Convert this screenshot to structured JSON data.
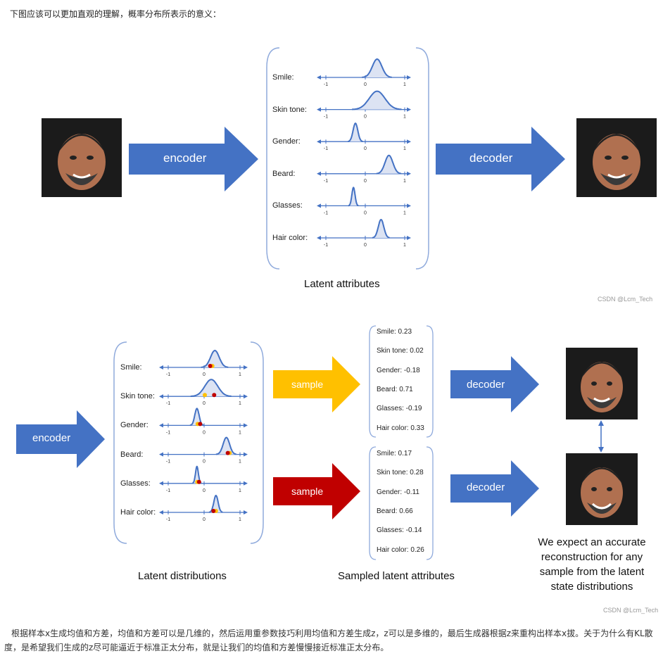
{
  "intro": "下图应该可以更加直观的理解，概率分布所表示的意义：",
  "top": {
    "encoder": "encoder",
    "decoder": "decoder",
    "caption": "Latent attributes",
    "attributes": [
      {
        "label": "Smile:",
        "mean": 0.3,
        "sigma": 0.12
      },
      {
        "label": "Skin tone:",
        "mean": 0.3,
        "sigma": 0.2
      },
      {
        "label": "Gender:",
        "mean": -0.25,
        "sigma": 0.06
      },
      {
        "label": "Beard:",
        "mean": 0.6,
        "sigma": 0.1
      },
      {
        "label": "Glasses:",
        "mean": -0.3,
        "sigma": 0.04
      },
      {
        "label": "Hair color:",
        "mean": 0.4,
        "sigma": 0.07
      }
    ],
    "ticks": [
      "-1",
      "0",
      "1"
    ],
    "watermark": "CSDN @Lcm_Tech"
  },
  "bottom": {
    "encoder": "encoder",
    "sample_yellow": "sample",
    "sample_red": "sample",
    "decoder1": "decoder",
    "decoder2": "decoder",
    "caption_left": "Latent distributions",
    "caption_mid": "Sampled latent attributes",
    "caption_right": [
      "We expect an accurate",
      "reconstruction for any",
      "sample from the latent",
      "state distributions"
    ],
    "attributes": [
      {
        "label": "Smile:",
        "mean": 0.3,
        "sigma": 0.12,
        "yellow": 0.23,
        "red": 0.17
      },
      {
        "label": "Skin tone:",
        "mean": 0.2,
        "sigma": 0.18,
        "yellow": 0.02,
        "red": 0.28
      },
      {
        "label": "Gender:",
        "mean": -0.2,
        "sigma": 0.06,
        "yellow": -0.18,
        "red": -0.11
      },
      {
        "label": "Beard:",
        "mean": 0.62,
        "sigma": 0.09,
        "yellow": 0.71,
        "red": 0.66
      },
      {
        "label": "Glasses:",
        "mean": -0.2,
        "sigma": 0.04,
        "yellow": -0.19,
        "red": -0.14
      },
      {
        "label": "Hair color:",
        "mean": 0.33,
        "sigma": 0.06,
        "yellow": 0.33,
        "red": 0.26
      }
    ],
    "ticks": [
      "-1",
      "0",
      "1"
    ],
    "samples1": [
      "Smile:  0.23",
      "Skin tone: 0.02",
      "Gender: -0.18",
      "Beard: 0.71",
      "Glasses: -0.19",
      "Hair color: 0.33"
    ],
    "samples2": [
      "Smile:  0.17",
      "Skin tone: 0.28",
      "Gender: -0.11",
      "Beard: 0.66",
      "Glasses: -0.14",
      "Hair color: 0.26"
    ],
    "watermark": "CSDN @Lcm_Tech"
  },
  "colors": {
    "blue": "#4472c4",
    "yellow": "#ffc000",
    "red": "#c00000",
    "bracket": "#8faadc"
  },
  "outro": "根据样本x生成均值和方差，均值和方差可以是几维的，然后运用重参数技巧利用均值和方差生成z，z可以是多维的，最后生成器根据z来重构出样本x拔。关于为什么有KL散度，是希望我们生成的z尽可能逼近于标准正太分布，就是让我们的均值和方差慢慢接近标准正太分布。"
}
